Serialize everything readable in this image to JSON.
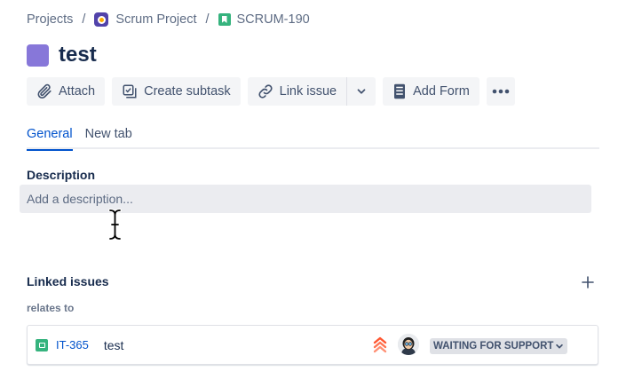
{
  "breadcrumb": {
    "projects": "Projects",
    "separator": "/",
    "project_name": "Scrum Project",
    "issue_key": "SCRUM-190"
  },
  "issue": {
    "title": "test",
    "type_color": "#8777d9"
  },
  "toolbar": {
    "attach": "Attach",
    "create_subtask": "Create subtask",
    "link_issue": "Link issue",
    "add_form": "Add Form"
  },
  "tabs": [
    {
      "label": "General",
      "active": true
    },
    {
      "label": "New tab",
      "active": false
    }
  ],
  "description": {
    "heading": "Description",
    "placeholder": "Add a description..."
  },
  "linked_issues": {
    "heading": "Linked issues",
    "relation": "relates to",
    "items": [
      {
        "key": "IT-365",
        "summary": "test",
        "priority_icon": "highest-priority-icon",
        "status": "WAITING FOR SUPPORT"
      }
    ]
  },
  "icons": {
    "attach": "paperclip-icon",
    "create_subtask": "subtask-icon",
    "link_issue": "link-icon",
    "add_form": "form-icon",
    "more": "more-icon",
    "add_link": "plus-icon"
  },
  "colors": {
    "accent": "#0052cc",
    "story": "#36b37e",
    "project": "#5243aa",
    "priority": "#ff5630"
  }
}
